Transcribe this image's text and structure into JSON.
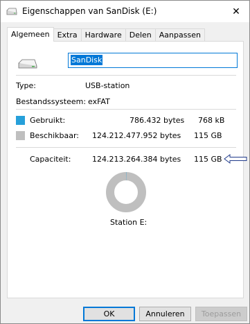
{
  "window": {
    "title": "Eigenschappen van SanDisk (E:)",
    "close_glyph": "✕"
  },
  "tabs": [
    {
      "label": "Algemeen",
      "active": true
    },
    {
      "label": "Extra"
    },
    {
      "label": "Hardware"
    },
    {
      "label": "Delen"
    },
    {
      "label": "Aanpassen"
    }
  ],
  "general": {
    "drive_name": "SanDisk",
    "type_label": "Type:",
    "type_value": "USB-station",
    "filesystem_label": "Bestandssysteem:",
    "filesystem_value": "exFAT",
    "used_label": "Gebruikt:",
    "used_bytes": "786.432 bytes",
    "used_short": "768 kB",
    "free_label": "Beschikbaar:",
    "free_bytes": "124.212.477.952 bytes",
    "free_short": "115 GB",
    "capacity_label": "Capaciteit:",
    "capacity_bytes": "124.213.264.384 bytes",
    "capacity_short": "115 GB",
    "drive_label": "Station E:",
    "used_fraction": 6.3e-06
  },
  "buttons": {
    "ok": "OK",
    "cancel": "Annuleren",
    "apply": "Toepassen"
  },
  "colors": {
    "used": "#26a0da",
    "free": "#bfbfbf",
    "accent": "#0078d7",
    "arrow": "#1f3a8a"
  },
  "icons": [
    "usb-drive-icon",
    "close-icon",
    "arrow-left-icon"
  ]
}
